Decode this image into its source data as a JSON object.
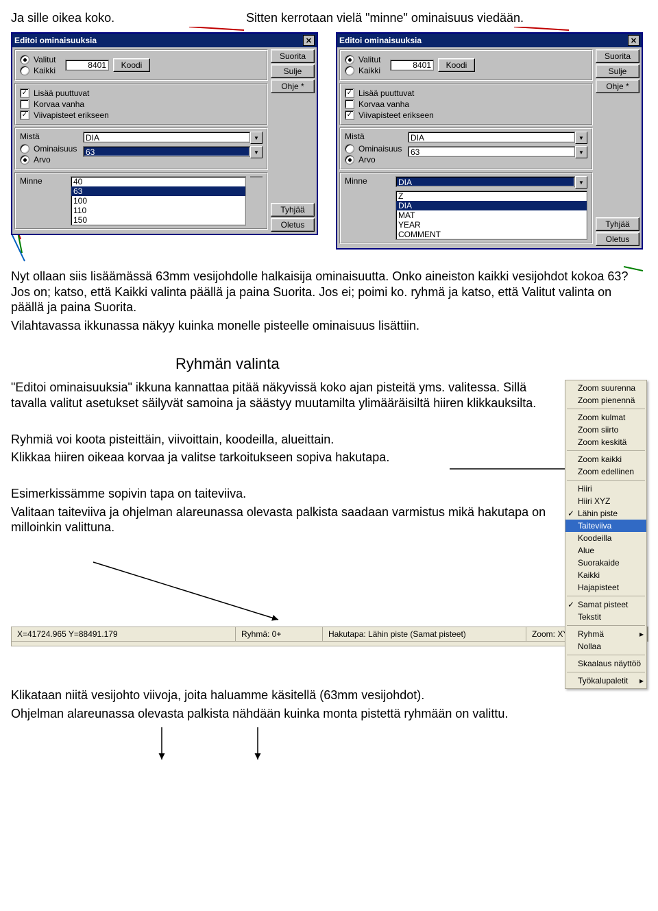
{
  "top": {
    "left": "Ja sille oikea koko.",
    "right": "Sitten kerrotaan vielä \"minne\" ominaisuus viedään."
  },
  "dialog": {
    "title": "Editoi ominaisuuksia",
    "radio_valitut": "Valitut",
    "radio_kaikki": "Kaikki",
    "code_value": "8401",
    "koodi_btn": "Koodi",
    "chk_lisaa": "Lisää puuttuvat",
    "chk_korvaa": "Korvaa vanha",
    "chk_viiva": "Viivapisteet erikseen",
    "mista": "Mistä",
    "ominaisuus": "Ominaisuus",
    "arvo": "Arvo",
    "minne": "Minne",
    "side_suorita": "Suorita",
    "side_sulje": "Sulje",
    "side_ohje": "Ohje *",
    "side_tyhjaa": "Tyhjää",
    "side_oletus": "Oletus",
    "mista_field1": "DIA",
    "left_arvo": "63",
    "left_list": [
      "40",
      "63",
      "100",
      "110",
      "150"
    ],
    "right_arvo": "63",
    "right_minne": "DIA",
    "right_list": [
      "Z",
      "DIA",
      "MAT",
      "YEAR",
      "COMMENT"
    ]
  },
  "para1": [
    "Nyt ollaan siis lisäämässä 63mm vesijohdolle halkaisija ominaisuutta. Onko aineiston kaikki vesijohdot  kokoa 63? Jos on; katso, että Kaikki valinta päällä ja paina Suorita. Jos ei; poimi ko. ryhmä ja katso, että Valitut valinta on päällä ja paina Suorita.",
    "Vilahtavassa ikkunassa näkyy kuinka monelle pisteelle ominaisuus lisättiin."
  ],
  "heading": "Ryhmän valinta",
  "para2": [
    "\"Editoi ominaisuuksia\" ikkuna kannattaa pitää  näkyvissä koko ajan pisteitä yms. valitessa. Sillä tavalla valitut asetukset säilyvät samoina ja säästyy muutamilta ylimääräisiltä hiiren klikkauksilta.",
    "",
    "Ryhmiä voi koota pisteittäin, viivoittain, koodeilla, alueittain.",
    "Klikkaa hiiren oikeaa korvaa ja valitse tarkoitukseen sopiva hakutapa.",
    "",
    "Esimerkissämme sopivin tapa on taiteviiva.",
    "Valitaan taiteviiva ja ohjelman alareunassa olevasta palkista saadaan varmistus mikä hakutapa on milloinkin valittuna."
  ],
  "menu": {
    "items1": [
      "Zoom suurenna",
      "Zoom pienennä"
    ],
    "items2": [
      "Zoom kulmat",
      "Zoom siirto",
      "Zoom keskitä"
    ],
    "items3": [
      "Zoom kaikki",
      "Zoom edellinen"
    ],
    "items4": [
      "Hiiri",
      "Hiiri XYZ",
      "Lähin piste",
      "Taiteviiva",
      "Koodeilla",
      "Alue",
      "Suorakaide",
      "Kaikki",
      "Hajapisteet"
    ],
    "items5": [
      "Samat pisteet",
      "Tekstit"
    ],
    "items6": [
      "Ryhmä",
      "Nollaa"
    ],
    "items7": [
      "Skaalaus näyttöö"
    ],
    "items8": [
      "Työkalupaletit"
    ],
    "checked4_idx": 2,
    "hilite4_idx": 3,
    "checked5_idx": 0
  },
  "statusbar": {
    "coords": "X=41724.965 Y=88491.179",
    "ryhma": "Ryhmä: 0+",
    "hakutapa": "Hakutapa: Lähin piste (Samat pisteet)",
    "zoom": "Zoom: XY"
  },
  "para3": [
    "Klikataan niitä vesijohto viivoja, joita haluamme käsitellä (63mm vesijohdot).",
    "Ohjelman alareunassa olevasta palkista nähdään kuinka monta pistettä ryhmään on valittu."
  ]
}
